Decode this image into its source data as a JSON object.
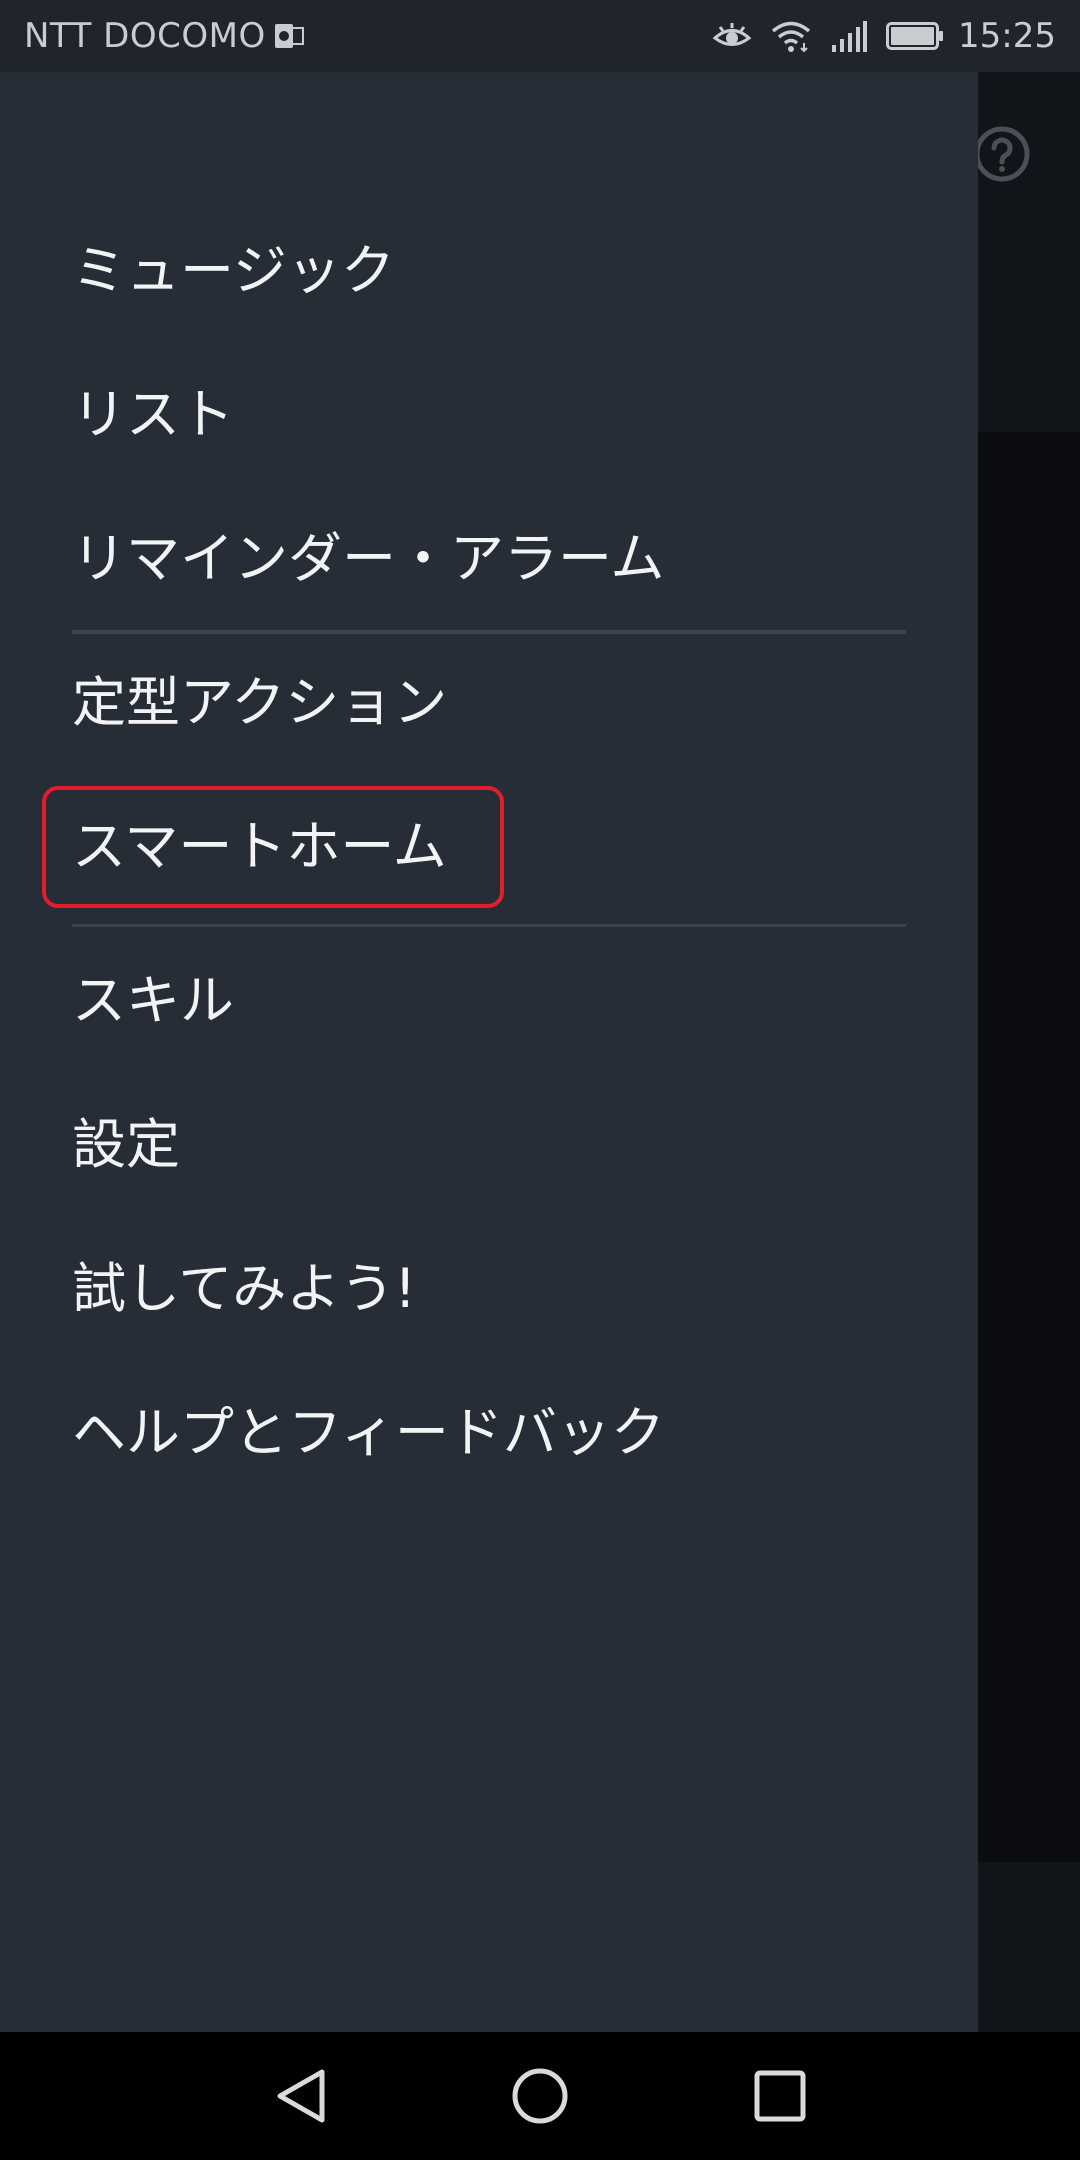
{
  "status_bar": {
    "carrier": "NTT DOCOMO",
    "time": "15:25"
  },
  "drawer": {
    "items": [
      {
        "label": "ミュージック"
      },
      {
        "label": "リスト"
      },
      {
        "label": "リマインダー・アラーム"
      },
      {
        "label": "定型アクション"
      },
      {
        "label": "スマートホーム",
        "highlighted": true
      },
      {
        "label": "スキル"
      },
      {
        "label": "設定"
      },
      {
        "label": "試してみよう!"
      },
      {
        "label": "ヘルプとフィードバック"
      }
    ]
  },
  "icons": {
    "status": [
      "outlook-notification-icon",
      "eye-comfort-icon",
      "wifi-icon",
      "signal-icon",
      "battery-icon"
    ],
    "app": [
      "help-icon"
    ],
    "nav": [
      "back-icon",
      "home-icon",
      "recents-icon"
    ]
  },
  "colors": {
    "drawer_bg": "#272d37",
    "highlight": "#e01e2d"
  }
}
